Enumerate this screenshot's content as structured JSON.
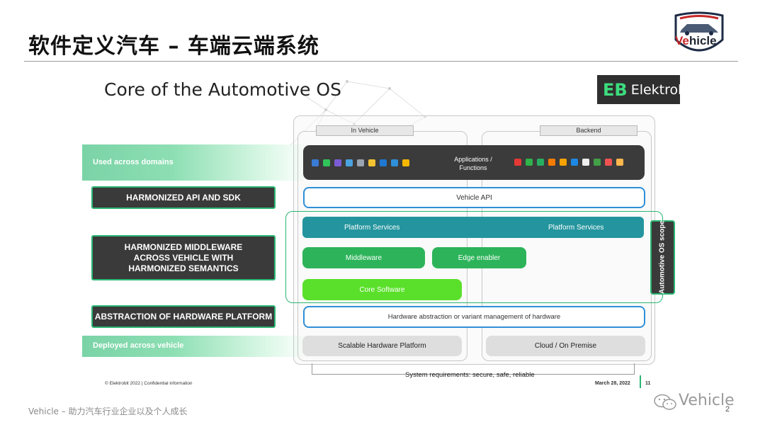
{
  "header": {
    "title": "软件定义汽车 – 车端云端系统",
    "logo_text_prefix": "Ve",
    "logo_text_suffix": "hicle",
    "logo_icon": "car-shield-logo"
  },
  "slide": {
    "title": "Core of the Automotive OS",
    "brand_mark": "EB",
    "brand_name": "Elektrobit",
    "columns": {
      "left": "In Vehicle",
      "right": "Backend"
    },
    "left_labels": {
      "used": "Used across domains",
      "api": "HARMONIZED API AND SDK",
      "middleware": "HARMONIZED MIDDLEWARE ACROSS VEHICLE WITH HARMONIZED SEMANTICS",
      "hardware": "ABSTRACTION OF HARDWARE PLATFORM",
      "deployed": "Deployed across vehicle"
    },
    "layers": {
      "applications": "Applications / Functions",
      "vehicle_api": "Vehicle API",
      "platform_services_left": "Platform Services",
      "platform_services_right": "Platform Services",
      "middleware": "Middleware",
      "edge_enabler": "Edge enabler",
      "core_software": "Core Software",
      "hardware_abstraction": "Hardware abstraction or variant management of hardware",
      "scalable_hardware": "Scalable Hardware Platform",
      "cloud": "Cloud / On Premise",
      "scope": "Automotive OS scope"
    },
    "app_icons_left": [
      {
        "name": "heart-icon",
        "color": "#3a7bd5"
      },
      {
        "name": "message-icon",
        "color": "#31c45a"
      },
      {
        "name": "phone-icon",
        "color": "#7b5cd6"
      },
      {
        "name": "photo-icon",
        "color": "#4aa3df"
      },
      {
        "name": "calendar-icon",
        "color": "#9aa4b1"
      },
      {
        "name": "settings-icon",
        "color": "#f2c230"
      },
      {
        "name": "parking-icon",
        "color": "#1f78d1"
      },
      {
        "name": "map-pin-icon",
        "color": "#2f8fd8"
      },
      {
        "name": "app-store-icon",
        "color": "#f5b800"
      }
    ],
    "app_icons_right": [
      {
        "name": "music-icon",
        "color": "#e53935"
      },
      {
        "name": "android-icon",
        "color": "#2fb34a"
      },
      {
        "name": "chat-icon",
        "color": "#27ae60"
      },
      {
        "name": "game-icon",
        "color": "#f57c00"
      },
      {
        "name": "weather-icon",
        "color": "#f4a300"
      },
      {
        "name": "browser-icon",
        "color": "#1e88e5"
      },
      {
        "name": "camera-icon",
        "color": "#eeeeee"
      },
      {
        "name": "star-icon",
        "color": "#43a047"
      },
      {
        "name": "shop-icon",
        "color": "#ef5350"
      },
      {
        "name": "box-icon",
        "color": "#ffb74d"
      }
    ],
    "system_requirements": "System requirements: secure, safe, reliable",
    "copyright": "© Elektrobit 2022 | Confidential information",
    "date": "March 28, 2022",
    "page_number": "11"
  },
  "footer": {
    "text": "Vehicle – 助力汽车行业企业以及个人成长",
    "watermark": "Vehicle",
    "slide_number": "2"
  },
  "colors": {
    "green_accent": "#2bb673",
    "teal": "#24959e",
    "blue_border": "#2f8fd8",
    "light_green": "#5ae02a",
    "dark_box": "#3a3a3a"
  }
}
